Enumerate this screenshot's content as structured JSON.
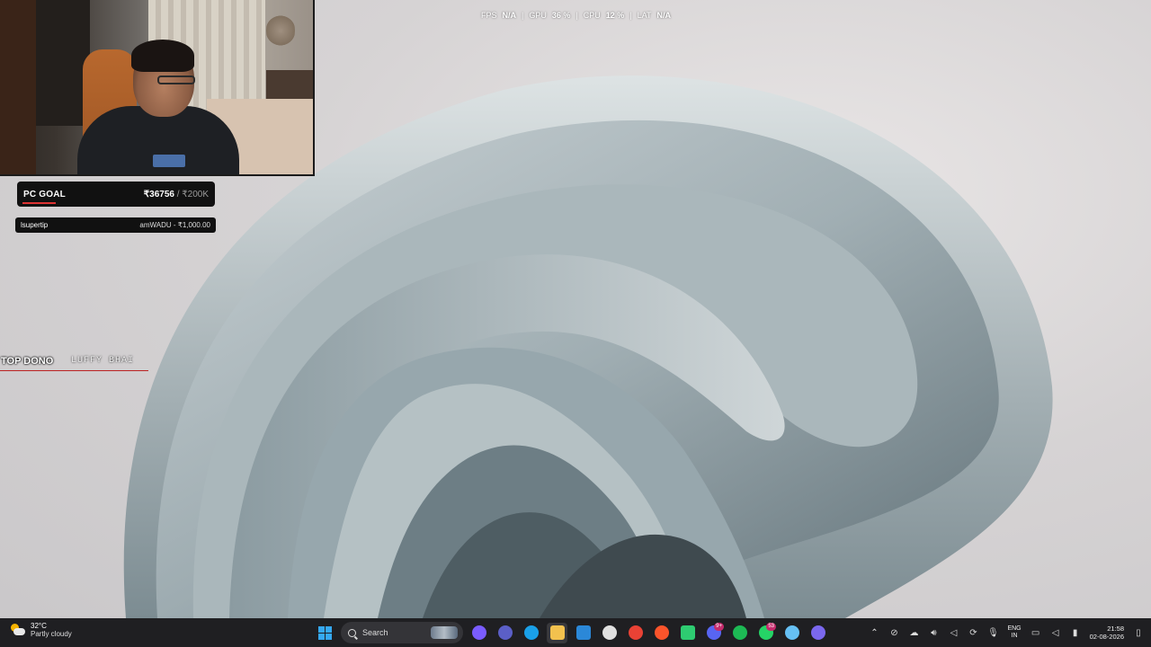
{
  "stats": {
    "fps_label": "FPS",
    "fps_value": "N/A",
    "gpu_label": "GPU",
    "gpu_value": "36 %",
    "cpu_label": "CPU",
    "cpu_value": "12 %",
    "lat_label": "LAT",
    "lat_value": "N/A",
    "separator": "|"
  },
  "goal": {
    "label": "PC GOAL",
    "current": "₹36756",
    "target": " / ₹200K",
    "progress_fraction": 0.18
  },
  "tip": {
    "label": "lsupertip",
    "value": "amWADU - ₹1,000.00"
  },
  "top_dono": {
    "label": "TOP DONO",
    "name": "LUFFY BHAI"
  },
  "taskbar": {
    "weather": {
      "temp": "32°C",
      "condition": "Partly cloudy"
    },
    "search_label": "Search",
    "apps": [
      {
        "name": "copilot",
        "color": "#7a5cff"
      },
      {
        "name": "teams",
        "color": "#5b5fc7"
      },
      {
        "name": "edge",
        "color": "#1aa0e8"
      },
      {
        "name": "file-explorer",
        "color": "#f2c14e"
      },
      {
        "name": "store",
        "color": "#2b88d8"
      },
      {
        "name": "browser-extra",
        "color": "#e0e0e0"
      },
      {
        "name": "chrome",
        "color": "#e94235"
      },
      {
        "name": "brave",
        "color": "#fb542b"
      },
      {
        "name": "terminal",
        "color": "#2ecc71"
      },
      {
        "name": "discord",
        "color": "#5865f2",
        "badge": "9+"
      },
      {
        "name": "spotify",
        "color": "#1db954"
      },
      {
        "name": "whatsapp",
        "color": "#25d366",
        "badge": "53"
      },
      {
        "name": "steam",
        "color": "#66c0f4"
      },
      {
        "name": "obs",
        "color": "#7b68ee"
      }
    ],
    "tray": {
      "lang_top": "ENG",
      "lang_bottom": "IN",
      "time": "21:58",
      "date": "02-08-2026"
    }
  },
  "colors": {
    "taskbar_bg": "#1f1f22",
    "accent_red": "#d33333",
    "windows_blue": "#35a8f2"
  }
}
